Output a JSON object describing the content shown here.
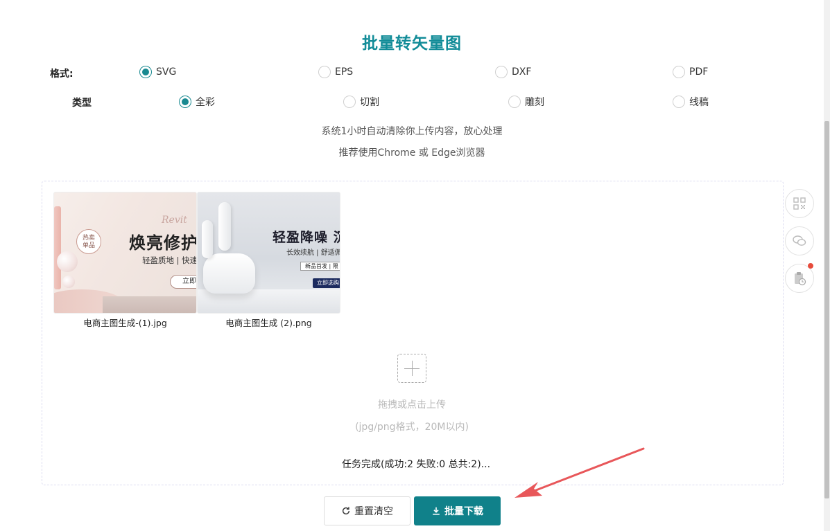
{
  "title": "批量转矢量图",
  "format": {
    "label": "格式:",
    "options": [
      "SVG",
      "EPS",
      "DXF",
      "PDF"
    ],
    "selected": "SVG"
  },
  "type": {
    "label": "类型",
    "options": [
      "全彩",
      "切割",
      "雕刻",
      "线稿"
    ],
    "selected": "全彩"
  },
  "notes": {
    "line1": "系统1小时自动清除你上传内容，放心处理",
    "line2": "推荐使用Chrome 或 Edge浏览器"
  },
  "files": [
    {
      "name": "电商主图生成-(1).jpg",
      "art": {
        "badge_line1": "热卖",
        "badge_line2": "单品",
        "script": "Revit",
        "headline": "焕亮修护",
        "sub": "轻盈质地 | 快速",
        "pill": "立即"
      }
    },
    {
      "name": "电商主图生成 (2).png",
      "art": {
        "headline": "轻盈降噪 沉",
        "sub": "长效续航 | 舒适佩戴",
        "tag": "新品首发 | 限",
        "button": "立即选购"
      }
    }
  ],
  "upload": {
    "hint": "拖拽或点击上传",
    "formats": "(jpg/png格式，20M以内)"
  },
  "status": "任务完成(成功:2 失败:0 总共:2)...",
  "buttons": {
    "reset": "重置清空",
    "download": "批量下载"
  },
  "icons": {
    "side": [
      "qrcode-icon",
      "wechat-icon",
      "clipboard-clock-icon"
    ],
    "reset": "refresh-icon",
    "download": "download-icon"
  },
  "colors": {
    "accent": "#10818a",
    "title": "#128c98",
    "annotation_arrow": "#e8575a",
    "notification_dot": "#e74c3c"
  }
}
